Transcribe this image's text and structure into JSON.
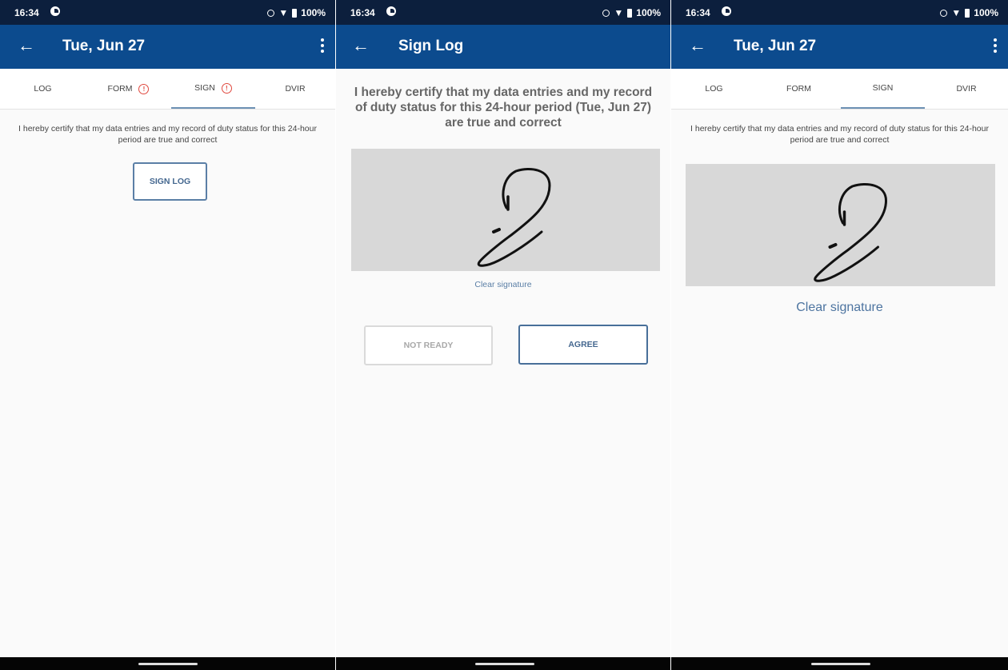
{
  "status_bar": {
    "time": "16:34",
    "battery": "100%"
  },
  "panel1": {
    "title": "Tue, Jun 27",
    "tabs": [
      {
        "label": "LOG"
      },
      {
        "label": "FORM",
        "alert": "!"
      },
      {
        "label": "SIGN",
        "alert": "!"
      },
      {
        "label": "DVIR"
      }
    ],
    "certification": "I hereby certify that my data entries and my record of duty status for this 24-hour period are true and correct",
    "sign_button": "SIGN LOG"
  },
  "panel2": {
    "title": "Sign Log",
    "certification": "I hereby certify that my data entries and my record of duty status for this 24-hour period (Tue, Jun 27) are true and correct",
    "clear_signature": "Clear signature",
    "not_ready_button": "NOT READY",
    "agree_button": "AGREE"
  },
  "panel3": {
    "title": "Tue, Jun 27",
    "tabs": [
      {
        "label": "LOG"
      },
      {
        "label": "FORM"
      },
      {
        "label": "SIGN"
      },
      {
        "label": "DVIR"
      }
    ],
    "certification": "I hereby certify that my data entries and my record of duty status for this 24-hour period are true and correct",
    "clear_signature": "Clear signature"
  },
  "colors": {
    "status_bar": "#0c1f3d",
    "app_bar": "#0c4b8e",
    "accent": "#44678f",
    "alert": "#e0483e",
    "signature_pad": "#d8d8d8"
  }
}
